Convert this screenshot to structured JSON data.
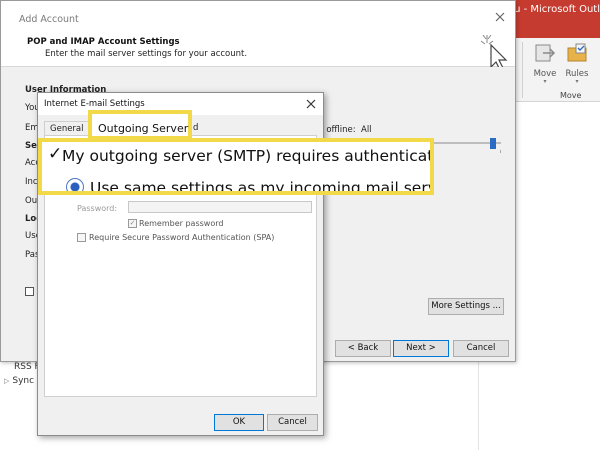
{
  "outlook": {
    "title": "S... ixu - Microsoft Outl",
    "ribbon": {
      "move": "Move",
      "rules": "Rules",
      "group_label": "Move"
    },
    "nav": [
      "RSS F",
      "Sync"
    ],
    "colors": {
      "title_bar": "#c63b2f",
      "highlight": "#f2d94a"
    }
  },
  "add_account": {
    "title": "Add Account",
    "header_title": "POP and IMAP Account Settings",
    "header_subtitle": "Enter the mail server settings for your account.",
    "section": "User Information",
    "partial_labels": [
      "You",
      "Ema",
      "Serv",
      "Acco",
      "Inco",
      "Outg",
      "Log",
      "Use",
      "Pass"
    ],
    "offline_label": "ep offline:",
    "offline_value": "All",
    "buttons": {
      "more_settings": "More Settings ...",
      "back": "< Back",
      "next": "Next >",
      "cancel": "Cancel"
    }
  },
  "internet_settings": {
    "title": "Internet E-mail Settings",
    "tabs": {
      "general": "General",
      "outgoing_server": "Outgoing Server",
      "partial": "d"
    },
    "password_label": "Password:",
    "remember_password": "Remember password",
    "spa": "Require Secure Password Authentication (SPA)",
    "buttons": {
      "ok": "OK",
      "cancel": "Cancel"
    }
  },
  "callout": {
    "tab_label": "Outgoing Server",
    "smtp_auth": "My outgoing server (SMTP) requires authentication",
    "same_settings": "Use same settings as my incoming mail server"
  }
}
